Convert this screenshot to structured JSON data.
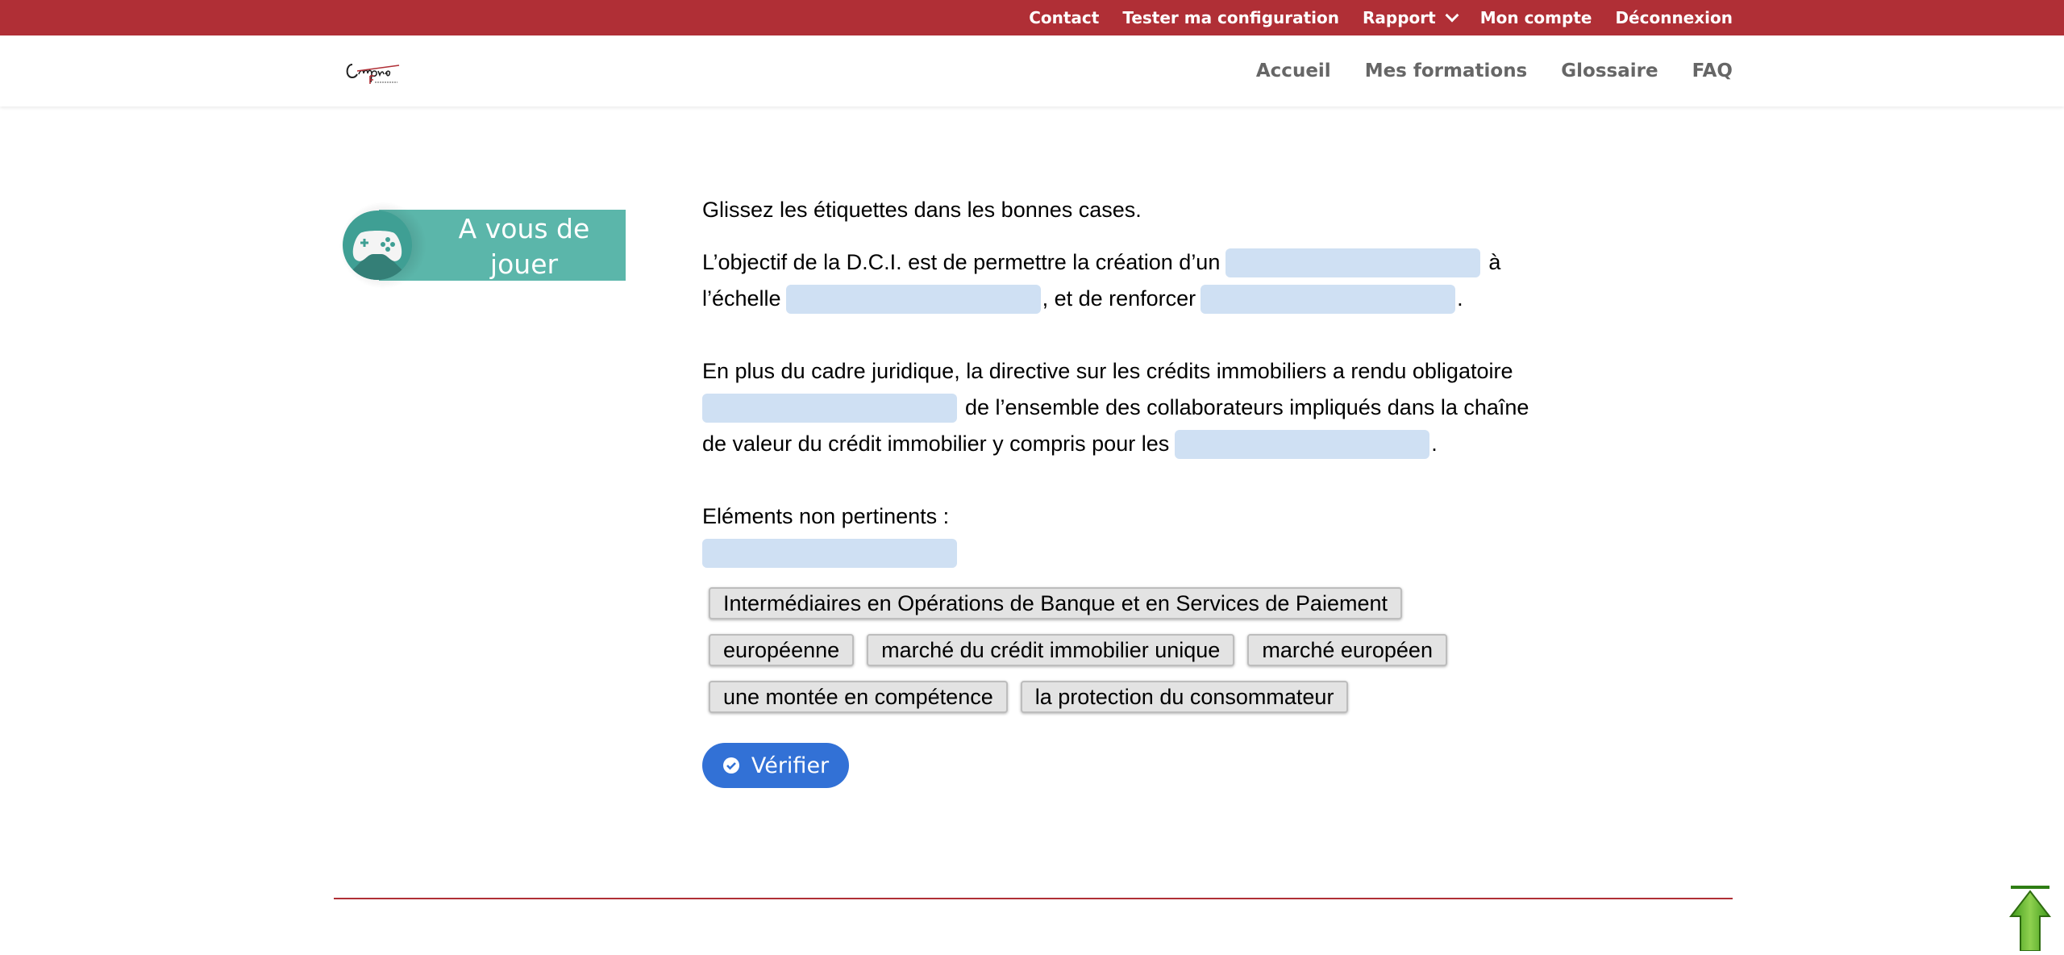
{
  "top_nav": {
    "contact": "Contact",
    "tester": "Tester ma configuration",
    "rapport": "Rapport",
    "mon_compte": "Mon compte",
    "deconnexion": "Déconnexion"
  },
  "main_nav": {
    "accueil": "Accueil",
    "mes_formations": "Mes formations",
    "glossaire": "Glossaire",
    "faq": "FAQ"
  },
  "badge": {
    "line1": "A vous de",
    "line2": "jouer",
    "icon": "gamepad-icon"
  },
  "exercise": {
    "instruction": "Glissez les étiquettes dans les bonnes cases.",
    "p1": {
      "a": "L’objectif de la D.C.I. est de permettre la création d’un",
      "b": "à",
      "c": "l’échelle",
      "d": ", et de renforcer",
      "e": "."
    },
    "p2": {
      "a": "En plus du cadre juridique, la directive sur les crédits immobiliers a rendu obligatoire",
      "b": "de l’ensemble des collaborateurs impliqués dans la chaîne",
      "c": "de valeur du crédit immobilier y compris pour les",
      "d": "."
    },
    "irrelevant_label": "Eléments non pertinents :",
    "chips": [
      "Intermédiaires en Opérations de Banque et en Services de Paiement",
      "européenne",
      "marché du crédit immobilier unique",
      "marché européen",
      "une montée en compétence",
      "la protection du consommateur"
    ],
    "verify_label": "Vérifier"
  },
  "colors": {
    "brand_red": "#b02f36",
    "drop_zone": "#cfe0f3",
    "button_blue": "#3271d6",
    "badge_teal": "#5bb6aa"
  }
}
